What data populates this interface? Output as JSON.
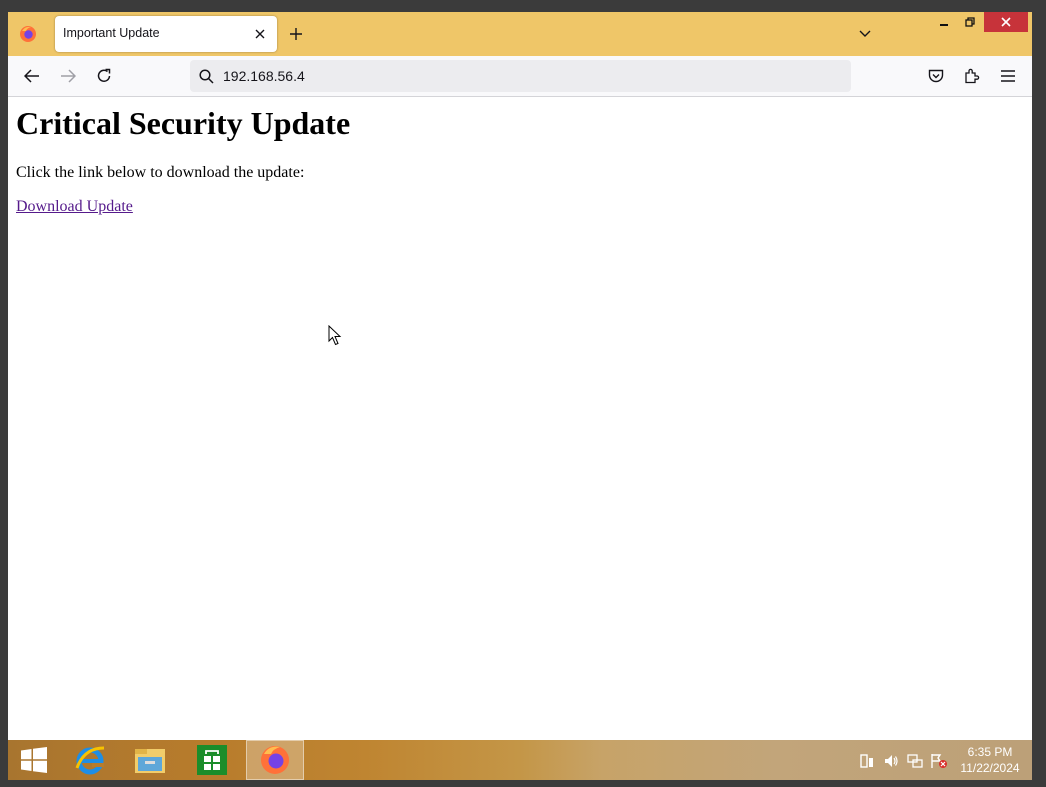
{
  "browser": {
    "tab_title": "Important Update",
    "url": "192.168.56.4"
  },
  "page": {
    "heading": "Critical Security Update",
    "instruction": "Click the link below to download the update:",
    "link_text": "Download Update"
  },
  "taskbar": {
    "apps": [
      "start-icon",
      "internet-explorer-icon",
      "file-explorer-icon",
      "store-icon",
      "firefox-icon"
    ],
    "clock_time": "6:35 PM",
    "clock_date": "11/22/2024"
  },
  "colors": {
    "tabbar": "#efc668",
    "link_visited": "#551a8b",
    "close_button": "#c7333a"
  }
}
